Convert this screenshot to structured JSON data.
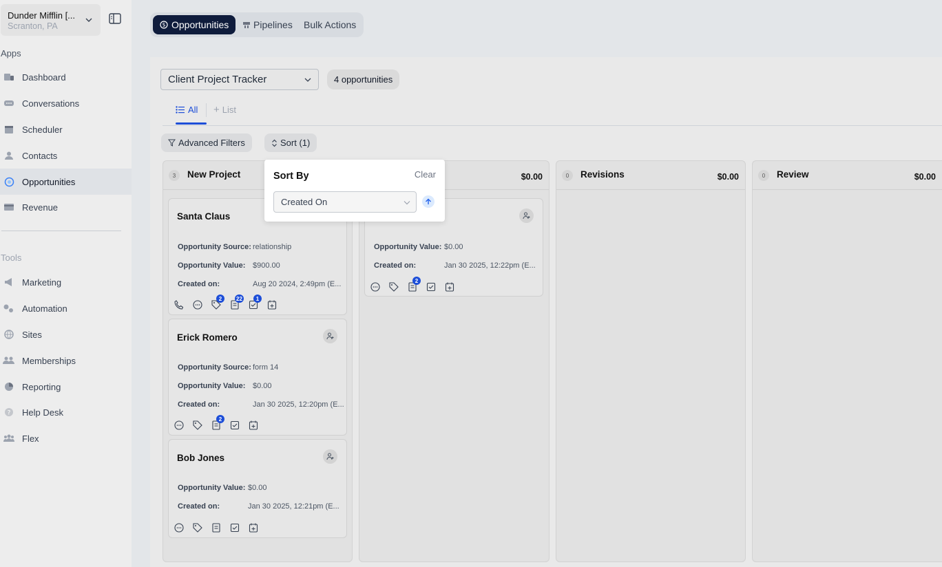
{
  "account": {
    "name": "Dunder Mifflin [...",
    "location": "Scranton, PA"
  },
  "sidebar": {
    "apps_label": "Apps",
    "apps": [
      {
        "label": "Dashboard",
        "icon": "dashboard-icon"
      },
      {
        "label": "Conversations",
        "icon": "chat-icon"
      },
      {
        "label": "Scheduler",
        "icon": "calendar-icon"
      },
      {
        "label": "Contacts",
        "icon": "user-icon"
      },
      {
        "label": "Opportunities",
        "icon": "target-icon",
        "active": true
      },
      {
        "label": "Revenue",
        "icon": "card-icon"
      }
    ],
    "tools_label": "Tools",
    "tools": [
      {
        "label": "Marketing",
        "icon": "megaphone-icon"
      },
      {
        "label": "Automation",
        "icon": "gears-icon"
      },
      {
        "label": "Sites",
        "icon": "globe-icon"
      },
      {
        "label": "Memberships",
        "icon": "members-icon"
      },
      {
        "label": "Reporting",
        "icon": "pie-icon"
      },
      {
        "label": "Help Desk",
        "icon": "help-icon"
      },
      {
        "label": "Flex",
        "icon": "group-icon"
      }
    ]
  },
  "topnav": {
    "opportunities": "Opportunities",
    "pipelines": "Pipelines",
    "bulk_actions": "Bulk Actions"
  },
  "pipeline": {
    "selected": "Client Project Tracker",
    "count_label": "4 opportunities"
  },
  "views": {
    "all": "All",
    "list": "List"
  },
  "filters": {
    "advanced": "Advanced Filters",
    "sort": "Sort (1)"
  },
  "sort_popover": {
    "title": "Sort By",
    "clear": "Clear",
    "field": "Created On"
  },
  "columns": [
    {
      "title": "New Project",
      "count": "3",
      "amount": ""
    },
    {
      "title": "",
      "count": "",
      "amount": "$0.00"
    },
    {
      "title": "Revisions",
      "count": "0",
      "amount": "$0.00"
    },
    {
      "title": "Review",
      "count": "0",
      "amount": "$0.00"
    }
  ],
  "cards": [
    {
      "name": "Santa Claus",
      "source_label": "Opportunity Source:",
      "source": "relationship",
      "value_label": "Opportunity Value:",
      "value": "$900.00",
      "created_label": "Created on:",
      "created": "Aug 20 2024, 2:49pm (E...",
      "badges": {
        "tag": "2",
        "notes": "22",
        "tasks": "1"
      }
    },
    {
      "name": "Erick Romero",
      "source_label": "Opportunity Source:",
      "source": "form 14",
      "value_label": "Opportunity Value:",
      "value": "$0.00",
      "created_label": "Created on:",
      "created": "Jan 30 2025, 12:20pm (E...",
      "badges": {
        "notes": "2"
      }
    },
    {
      "name": "Bob Jones",
      "value_label": "Opportunity Value:",
      "value": "$0.00",
      "created_label": "Created on:",
      "created": "Jan 30 2025, 12:21pm (E..."
    },
    {
      "name": "",
      "value_label": "Opportunity Value:",
      "value": "$0.00",
      "created_label": "Created on:",
      "created": "Jan 30 2025, 12:22pm (E...",
      "badges": {
        "notes": "2"
      }
    }
  ],
  "colors": {
    "accent": "#1d4ed8",
    "active_tab_bg": "#0f1c3c"
  }
}
